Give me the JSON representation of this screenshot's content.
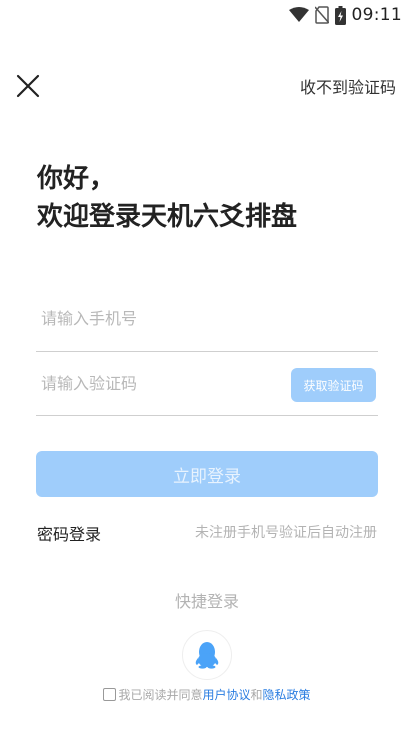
{
  "status_bar": {
    "time": "09:11",
    "icons": [
      "wifi-icon",
      "no-sim-icon",
      "battery-charging-icon"
    ]
  },
  "header": {
    "close_icon": "close-icon",
    "help_link": "收不到验证码"
  },
  "greeting": {
    "line1": "你好，",
    "line2": "欢迎登录天机六爻排盘"
  },
  "form": {
    "phone_placeholder": "请输入手机号",
    "code_placeholder": "请输入验证码",
    "get_code_label": "获取验证码",
    "login_label": "立即登录"
  },
  "footer_links": {
    "password_login": "密码登录",
    "register_hint": "未注册手机号验证后自动注册"
  },
  "quick_login": {
    "label": "快捷登录",
    "qq_icon": "qq-penguin-icon"
  },
  "agreement": {
    "prefix": "我已阅读并同意",
    "user_agreement": "用户协议",
    "and": "和",
    "privacy_policy": "隐私政策"
  },
  "colors": {
    "accent_light": "#9fcdfb",
    "link": "#2a7de1",
    "qq_blue": "#4ba3f8"
  }
}
